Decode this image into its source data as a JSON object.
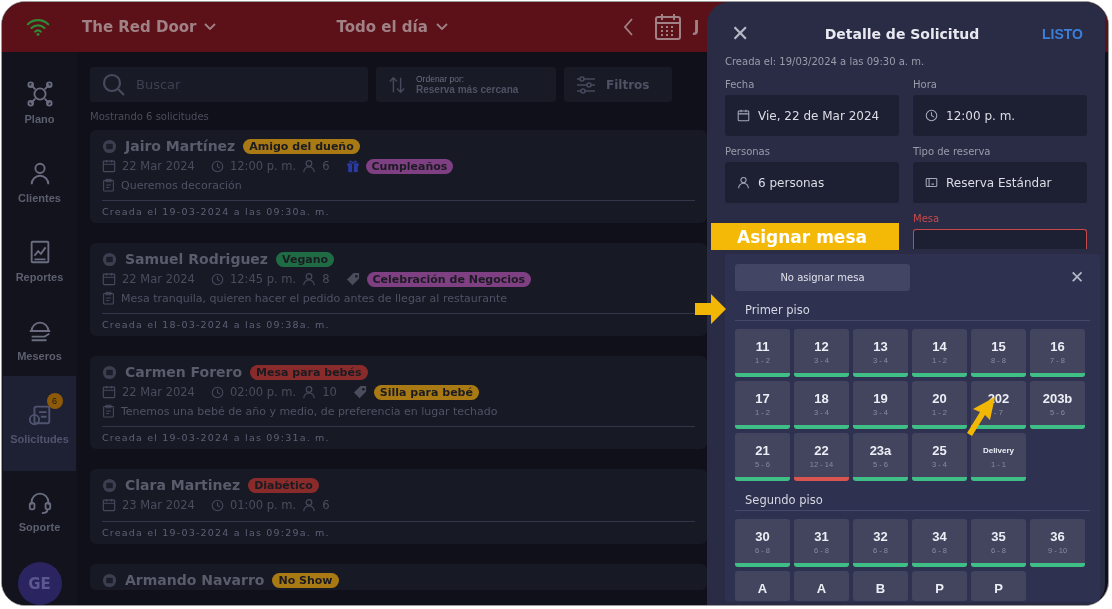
{
  "topbar": {
    "venue": "The Red Door",
    "shift": "Todo el día",
    "date_fragment": "J"
  },
  "sidebar": {
    "items": [
      {
        "label": "Plano",
        "selected": false
      },
      {
        "label": "Clientes",
        "selected": false
      },
      {
        "label": "Reportes",
        "selected": false
      },
      {
        "label": "Meseros",
        "selected": false
      },
      {
        "label": "Solicitudes",
        "selected": true,
        "badge": "6"
      },
      {
        "label": "Soporte",
        "selected": false
      }
    ],
    "avatar": "GE"
  },
  "toolbar": {
    "search": {
      "placeholder": "Buscar"
    },
    "sort": {
      "caption": "Ordenar por:",
      "value": "Reserva más cercana"
    },
    "filters": "Filtros"
  },
  "count_text": "Mostrando 6 solicitudes",
  "requests": [
    {
      "name": "Jairo Martínez",
      "tag": {
        "text": "Amigo del dueño",
        "color": "#a97a14"
      },
      "date": "22 Mar 2024",
      "time": "12:00 p. m.",
      "people": "6",
      "extra": {
        "kind": "gift",
        "text": "Cumpleaños",
        "color": "#7e3f83"
      },
      "note": "Queremos decoración",
      "created": "Creada el 19-03-2024 a las 09:30a. m."
    },
    {
      "name": "Samuel Rodriguez",
      "tag": {
        "text": "Vegano",
        "color": "#1f6b43"
      },
      "date": "22 Mar 2024",
      "time": "12:45 p. m.",
      "people": "8",
      "extra": {
        "kind": "label",
        "text": "Celebración de Negocios",
        "color": "#7e3f83"
      },
      "note": "Mesa tranquila, quieren hacer el pedido antes de llegar al restaurante",
      "created": "Creada el 18-03-2024 a las 09:38a. m."
    },
    {
      "name": "Carmen Forero",
      "tag": {
        "text": "Mesa para bebés",
        "color": "#8a2b2b"
      },
      "date": "22 Mar 2024",
      "time": "02:00 p. m.",
      "people": "10",
      "extra": {
        "kind": "label",
        "text": "Silla para bebé",
        "color": "#a97a14"
      },
      "note": "Tenemos una bebé de año y medio, de preferencia en lugar techado",
      "created": "Creada el 19-03-2024 a las 09:31a. m."
    },
    {
      "name": "Clara Martinez",
      "tag": {
        "text": "Diabético",
        "color": "#8a2b2b"
      },
      "date": "23 Mar 2024",
      "time": "01:00 p. m.",
      "people": "6",
      "created": "Creada el 19-03-2024 a las 09:29a. m."
    },
    {
      "name": "Armando Navarro",
      "tag": {
        "text": "No Show",
        "color": "#a97a14"
      }
    }
  ],
  "drawer": {
    "close": "✕",
    "title": "Detalle de Solicitud",
    "done": "LISTO",
    "created": "Creada el: 19/03/2024 a las 09:30 a. m.",
    "fields": [
      {
        "label": "Fecha",
        "value": "Vie, 22 de Mar 2024"
      },
      {
        "label": "Hora",
        "value": "12:00 p. m."
      },
      {
        "label": "Personas",
        "value": "6 personas"
      },
      {
        "label": "Tipo de reserva",
        "value": "Reserva Estándar"
      }
    ],
    "mesa_label": "Mesa"
  },
  "picker": {
    "no_table": "No asignar mesa",
    "close": "✕",
    "floors": [
      {
        "name": "Primer piso",
        "tables": [
          {
            "name": "11",
            "seats": "1 - 2",
            "available": true
          },
          {
            "name": "12",
            "seats": "3 - 4",
            "available": true
          },
          {
            "name": "13",
            "seats": "3 - 4",
            "available": true
          },
          {
            "name": "14",
            "seats": "1 - 2",
            "available": true
          },
          {
            "name": "15",
            "seats": "8 - 8",
            "available": true
          },
          {
            "name": "16",
            "seats": "7 - 8",
            "available": true
          },
          {
            "name": "17",
            "seats": "1 - 2",
            "available": true
          },
          {
            "name": "18",
            "seats": "3 - 4",
            "available": true
          },
          {
            "name": "19",
            "seats": "3 - 4",
            "available": true
          },
          {
            "name": "20",
            "seats": "1 - 2",
            "available": true
          },
          {
            "name": "202",
            "seats": "- 7",
            "available": true
          },
          {
            "name": "203b",
            "seats": "5 - 6",
            "available": true
          },
          {
            "name": "21",
            "seats": "5 - 6",
            "available": true
          },
          {
            "name": "22",
            "seats": "12 - 14",
            "available": false
          },
          {
            "name": "23a",
            "seats": "5 - 6",
            "available": true
          },
          {
            "name": "25",
            "seats": "3 - 4",
            "available": true
          },
          {
            "name": "Delivery",
            "seats": "1 - 1",
            "available": true
          }
        ]
      },
      {
        "name": "Segundo piso",
        "tables": [
          {
            "name": "30",
            "seats": "6 - 8",
            "available": true
          },
          {
            "name": "31",
            "seats": "6 - 8",
            "available": true
          },
          {
            "name": "32",
            "seats": "6 - 8",
            "available": true
          },
          {
            "name": "34",
            "seats": "6 - 8",
            "available": true
          },
          {
            "name": "35",
            "seats": "6 - 8",
            "available": true
          },
          {
            "name": "36",
            "seats": "9 - 10",
            "available": true
          },
          {
            "name": "A"
          },
          {
            "name": "A"
          },
          {
            "name": "B"
          },
          {
            "name": "P"
          },
          {
            "name": "P"
          }
        ]
      }
    ]
  },
  "callout": "Asignar mesa"
}
